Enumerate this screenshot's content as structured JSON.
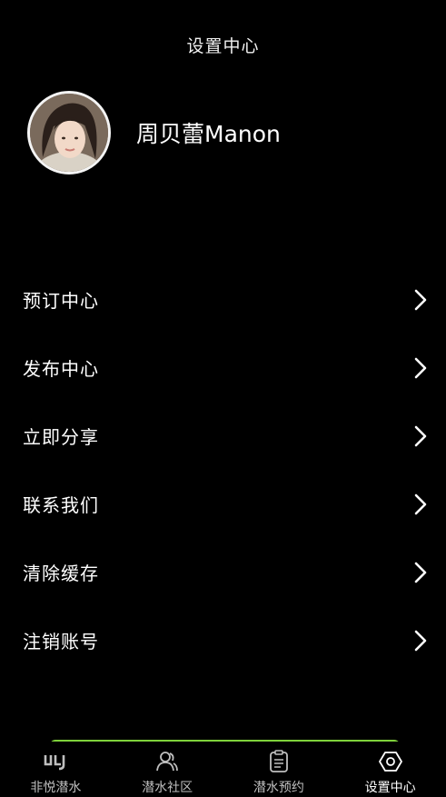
{
  "header": {
    "title": "设置中心"
  },
  "profile": {
    "username": "周贝蕾Manon",
    "avatar_icon": "avatar-photo"
  },
  "menu": {
    "items": [
      {
        "label": "预订中心"
      },
      {
        "label": "发布中心"
      },
      {
        "label": "立即分享"
      },
      {
        "label": "联系我们"
      },
      {
        "label": "清除缓存"
      },
      {
        "label": "注销账号"
      }
    ]
  },
  "tabbar": {
    "accent": "#7fd13b",
    "tabs": [
      {
        "label": "非悦潜水",
        "icon": "brand-logo-icon",
        "active": false
      },
      {
        "label": "潜水社区",
        "icon": "community-icon",
        "active": false
      },
      {
        "label": "潜水预约",
        "icon": "clipboard-icon",
        "active": false
      },
      {
        "label": "设置中心",
        "icon": "hexagon-settings-icon",
        "active": true
      }
    ]
  }
}
